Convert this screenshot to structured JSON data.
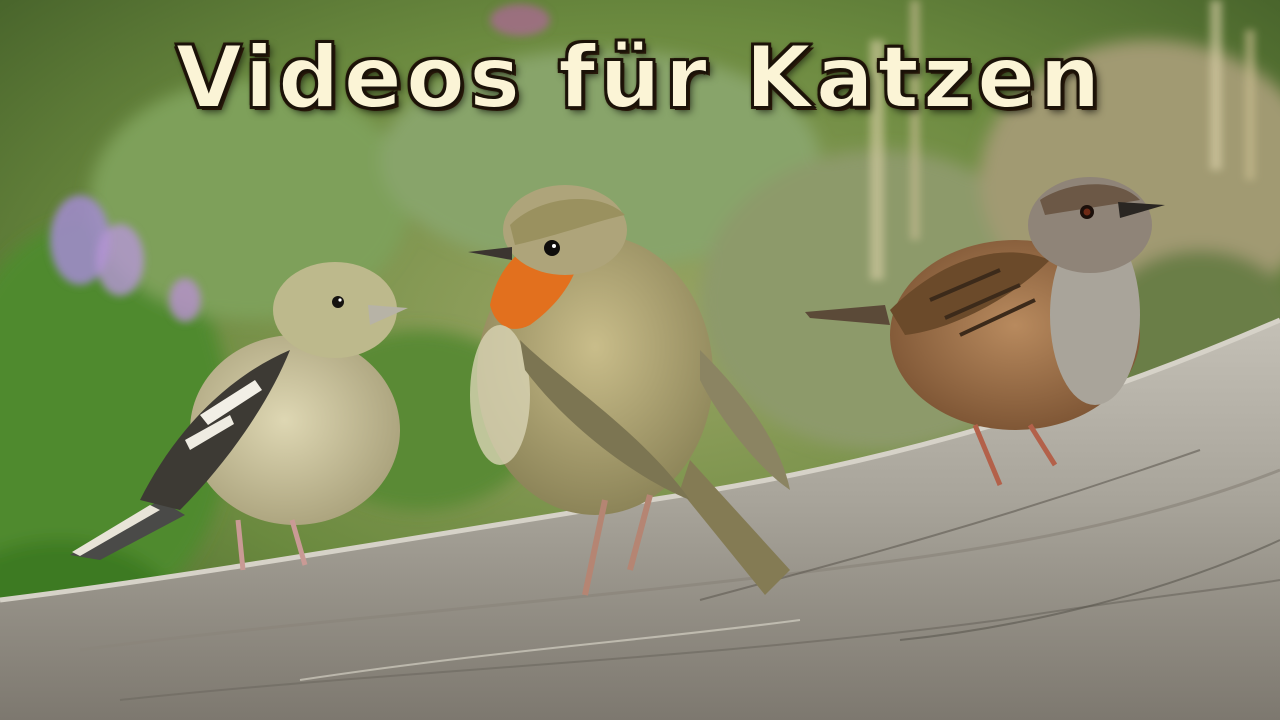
{
  "thumbnail": {
    "title": "Videos für Katzen"
  },
  "scene": {
    "subjects": [
      "chaffinch",
      "robin",
      "dunnock"
    ],
    "colors": {
      "background_green": "#6b8a3f",
      "log_gray": "#a9a59c",
      "robin_breast": "#e2701e",
      "title_fill": "#fbf4d6"
    }
  }
}
